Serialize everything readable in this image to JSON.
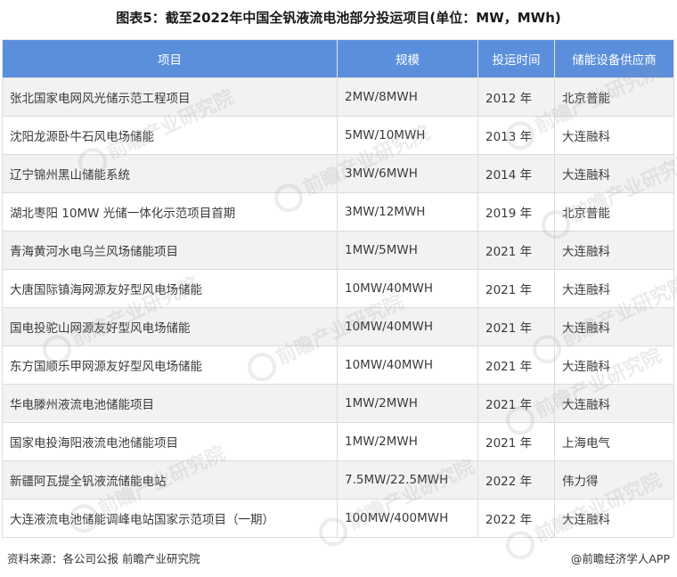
{
  "title": "图表5：截至2022年中国全钒液流电池部分投运项目(单位：MW，MWh)",
  "table": {
    "headers": [
      "项目",
      "规模",
      "投运时间",
      "储能设备供应商"
    ],
    "rows": [
      [
        "张北国家电网风光储示范工程项目",
        "2MW/8MWH",
        "2012 年",
        "北京普能"
      ],
      [
        "沈阳龙源卧牛石风电场储能",
        "5MW/10MWH",
        "2013 年",
        "大连融科"
      ],
      [
        "辽宁锦州黑山储能系统",
        "3MW/6MWH",
        "2014 年",
        "大连融科"
      ],
      [
        "湖北枣阳 10MW 光储一体化示范项目首期",
        "3MW/12MWH",
        "2019 年",
        "北京普能"
      ],
      [
        "青海黄河水电乌兰风场储能项目",
        "1MW/5MWH",
        "2021 年",
        "大连融科"
      ],
      [
        "大唐国际镇海网源友好型风电场储能",
        "10MW/40MWH",
        "2021 年",
        "大连融科"
      ],
      [
        "国电投驼山网源友好型风电场储能",
        "10MW/40MWH",
        "2021 年",
        "大连融科"
      ],
      [
        "东方国顺乐甲网源友好型风电场储能",
        "10MW/40MWH",
        "2021 年",
        "大连融科"
      ],
      [
        "华电滕州液流电池储能项目",
        "1MW/2MWH",
        "2021 年",
        "大连融科"
      ],
      [
        "国家电投海阳液流电池储能项目",
        "1MW/2MWH",
        "2021 年",
        "上海电气"
      ],
      [
        "新疆阿瓦提全钒液流储能电站",
        "7.5MW/22.5MWH",
        "2022 年",
        "伟力得"
      ],
      [
        "大连液流电池储能调峰电站国家示范项目（一期）",
        "100MW/400MWH",
        "2022 年",
        "大连融科"
      ]
    ]
  },
  "footer": {
    "source": "资料来源：各公司公报 前瞻产业研究院",
    "credit": "@前瞻经济学人APP"
  },
  "watermark": {
    "text": "前瞻产业研究院"
  }
}
